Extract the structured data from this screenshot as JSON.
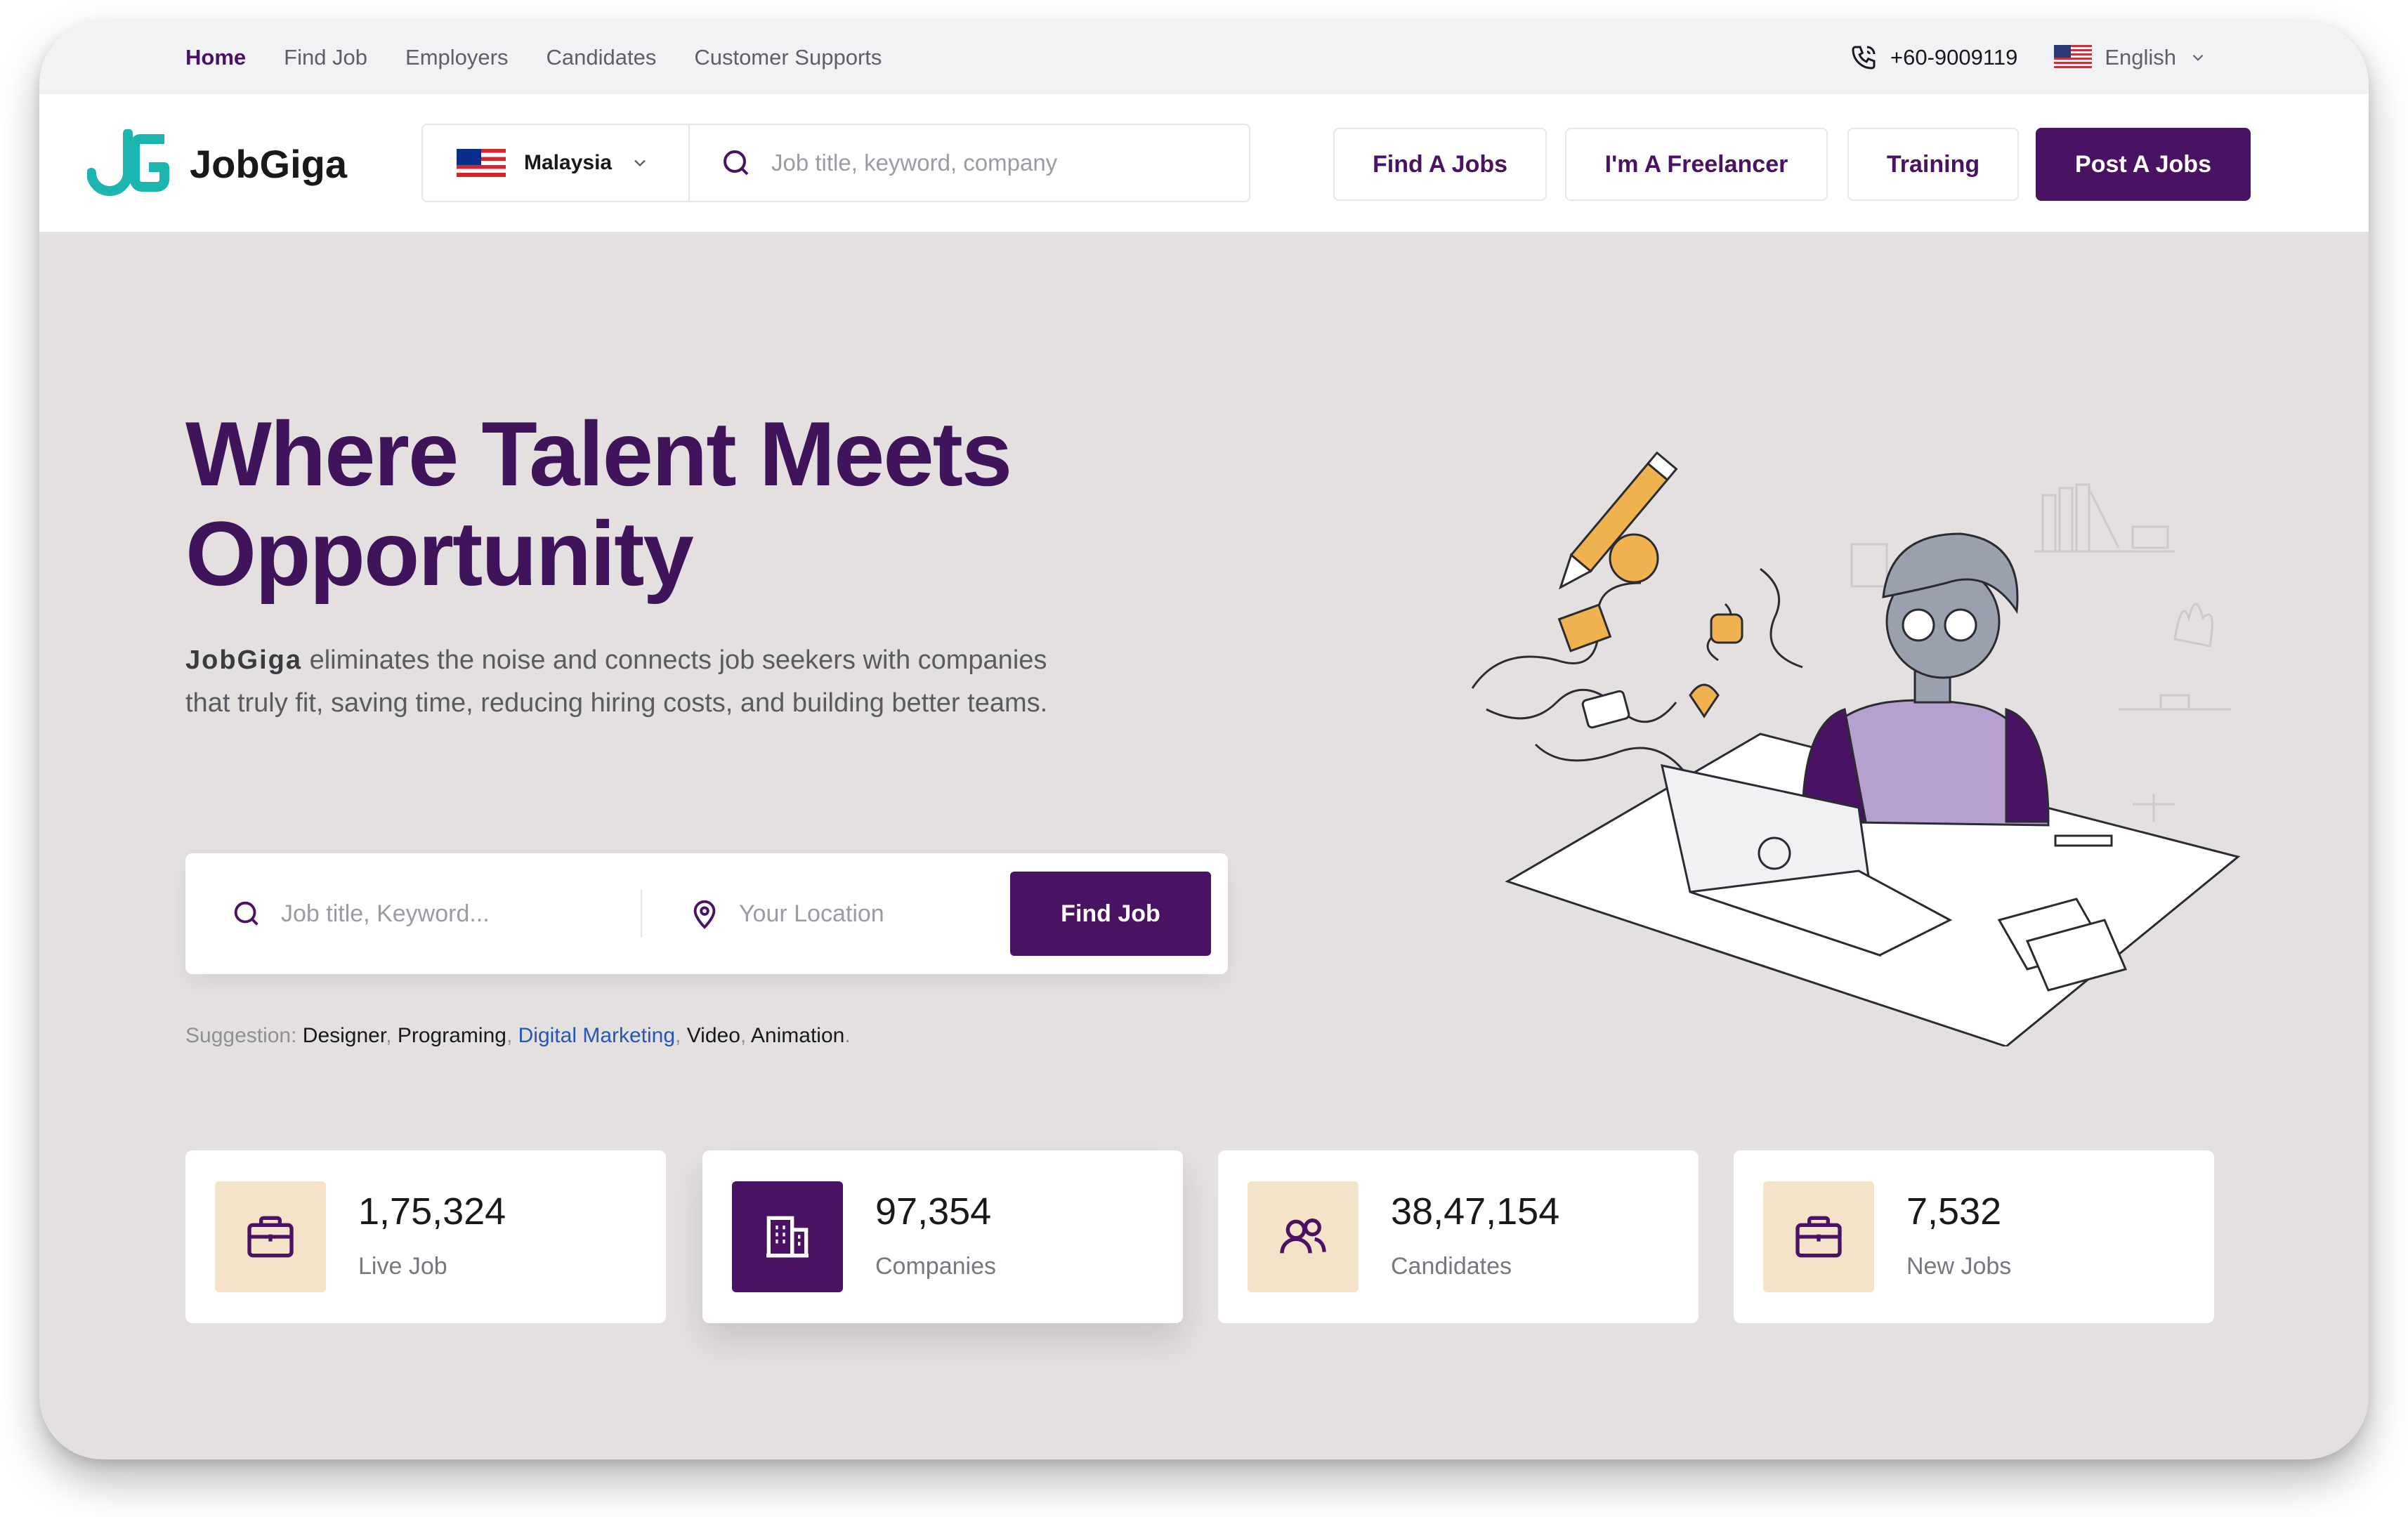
{
  "top_nav": {
    "links": [
      {
        "label": "Home",
        "active": true
      },
      {
        "label": "Find Job"
      },
      {
        "label": "Employers"
      },
      {
        "label": "Candidates"
      },
      {
        "label": "Customer Supports"
      }
    ],
    "phone": "+60-9009119",
    "language": "English"
  },
  "header": {
    "logo": "JobGiga",
    "country": "Malaysia",
    "search_placeholder": "Job title, keyword, company",
    "buttons": {
      "find_jobs": "Find A Jobs",
      "freelancer": "I'm A Freelancer",
      "training": "Training",
      "post_jobs": "Post A Jobs"
    }
  },
  "hero": {
    "title_line1": "Where Talent Meets",
    "title_line2": "Opportunity",
    "desc_brand": "JobGiga",
    "desc_text": " eliminates the noise and connects job seekers with companies that truly fit, saving time, reducing hiring costs, and building better teams.",
    "search": {
      "keyword_placeholder": "Job title, Keyword...",
      "location_placeholder": "Your Location",
      "button": "Find Job"
    },
    "suggestion": {
      "label": "Suggestion: ",
      "items": [
        "Designer",
        "Programing",
        "Digital Marketing",
        "Video",
        "Animation"
      ],
      "highlighted": "Digital Marketing"
    }
  },
  "stats": [
    {
      "value": "1,75,324",
      "label": "Live Job",
      "icon": "briefcase-icon"
    },
    {
      "value": "97,354",
      "label": "Companies",
      "icon": "building-icon"
    },
    {
      "value": "38,47,154",
      "label": "Candidates",
      "icon": "users-icon"
    },
    {
      "value": "7,532",
      "label": "New Jobs",
      "icon": "briefcase-icon"
    }
  ],
  "colors": {
    "brand": "#4a1263",
    "accent": "#1cb5b0",
    "icon_bg_light": "#f3e4c9",
    "link": "#2557b4"
  }
}
